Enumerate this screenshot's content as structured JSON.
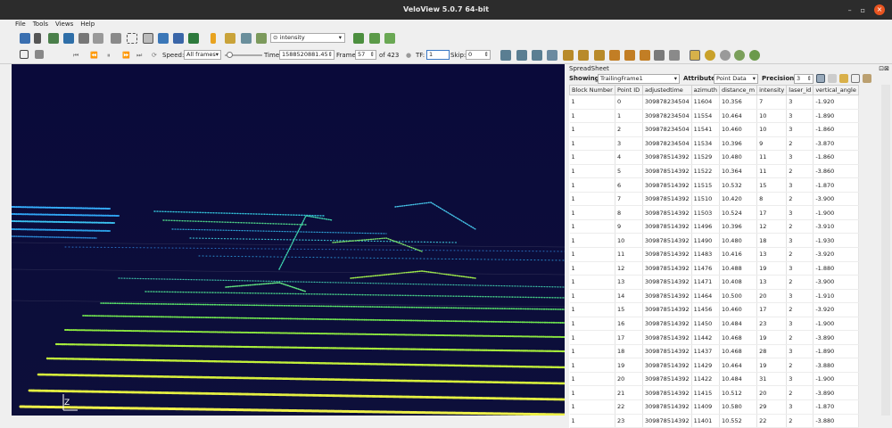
{
  "window": {
    "title": "VeloView 5.0.7 64-bit",
    "minimize": "–",
    "maximize": "▫",
    "close": "×"
  },
  "menu": [
    "File",
    "Tools",
    "Views",
    "Help"
  ],
  "toolbar": {
    "color_by": "intensity"
  },
  "playback": {
    "speed_label": "Speed:",
    "speed_value": "All frames",
    "time_label": "Time:",
    "time_value": "1588520881.45",
    "frame_label": "Frame",
    "frame_value": "57",
    "frame_total": "of 423",
    "tf_label": "TF:",
    "tf_value": "1",
    "skip_label": "Skip:",
    "skip_value": "0"
  },
  "viewport": {
    "axis_label": "Z"
  },
  "spreadsheet": {
    "panel_title": "SpreadSheet",
    "showing_label": "Showing",
    "showing_value": "TrailingFrame1",
    "attribute_label": "Attribute:",
    "attribute_value": "Point Data",
    "precision_label": "Precision:",
    "precision_value": "3",
    "columns": [
      "Block Number",
      "Point ID",
      "adjustedtime",
      "azimuth",
      "distance_m",
      "intensity",
      "laser_id",
      "vertical_angle"
    ],
    "rows": [
      [
        "1",
        "0",
        "309878234504",
        "11604",
        "10.356",
        "7",
        "3",
        "-1.920"
      ],
      [
        "1",
        "1",
        "309878234504",
        "11554",
        "10.464",
        "10",
        "3",
        "-1.890"
      ],
      [
        "1",
        "2",
        "309878234504",
        "11541",
        "10.460",
        "10",
        "3",
        "-1.860"
      ],
      [
        "1",
        "3",
        "309878234504",
        "11534",
        "10.396",
        "9",
        "2",
        "-3.870"
      ],
      [
        "1",
        "4",
        "309878514392",
        "11529",
        "10.480",
        "11",
        "3",
        "-1.860"
      ],
      [
        "1",
        "5",
        "309878514392",
        "11522",
        "10.364",
        "11",
        "2",
        "-3.860"
      ],
      [
        "1",
        "6",
        "309878514392",
        "11515",
        "10.532",
        "15",
        "3",
        "-1.870"
      ],
      [
        "1",
        "7",
        "309878514392",
        "11510",
        "10.420",
        "8",
        "2",
        "-3.900"
      ],
      [
        "1",
        "8",
        "309878514392",
        "11503",
        "10.524",
        "17",
        "3",
        "-1.900"
      ],
      [
        "1",
        "9",
        "309878514392",
        "11496",
        "10.396",
        "12",
        "2",
        "-3.910"
      ],
      [
        "1",
        "10",
        "309878514392",
        "11490",
        "10.480",
        "18",
        "3",
        "-1.930"
      ],
      [
        "1",
        "11",
        "309878514392",
        "11483",
        "10.416",
        "13",
        "2",
        "-3.920"
      ],
      [
        "1",
        "12",
        "309878514392",
        "11476",
        "10.488",
        "19",
        "3",
        "-1.880"
      ],
      [
        "1",
        "13",
        "309878514392",
        "11471",
        "10.408",
        "13",
        "2",
        "-3.900"
      ],
      [
        "1",
        "14",
        "309878514392",
        "11464",
        "10.500",
        "20",
        "3",
        "-1.910"
      ],
      [
        "1",
        "15",
        "309878514392",
        "11456",
        "10.460",
        "17",
        "2",
        "-3.920"
      ],
      [
        "1",
        "16",
        "309878514392",
        "11450",
        "10.484",
        "23",
        "3",
        "-1.900"
      ],
      [
        "1",
        "17",
        "309878514392",
        "11442",
        "10.468",
        "19",
        "2",
        "-3.890"
      ],
      [
        "1",
        "18",
        "309878514392",
        "11437",
        "10.468",
        "28",
        "3",
        "-1.890"
      ],
      [
        "1",
        "19",
        "309878514392",
        "11429",
        "10.464",
        "19",
        "2",
        "-3.880"
      ],
      [
        "1",
        "20",
        "309878514392",
        "11422",
        "10.484",
        "31",
        "3",
        "-1.900"
      ],
      [
        "1",
        "21",
        "309878514392",
        "11415",
        "10.512",
        "20",
        "2",
        "-3.890"
      ],
      [
        "1",
        "22",
        "309878514392",
        "11409",
        "10.580",
        "29",
        "3",
        "-1.870"
      ],
      [
        "1",
        "23",
        "309878514392",
        "11401",
        "10.552",
        "22",
        "2",
        "-3.880"
      ]
    ]
  }
}
